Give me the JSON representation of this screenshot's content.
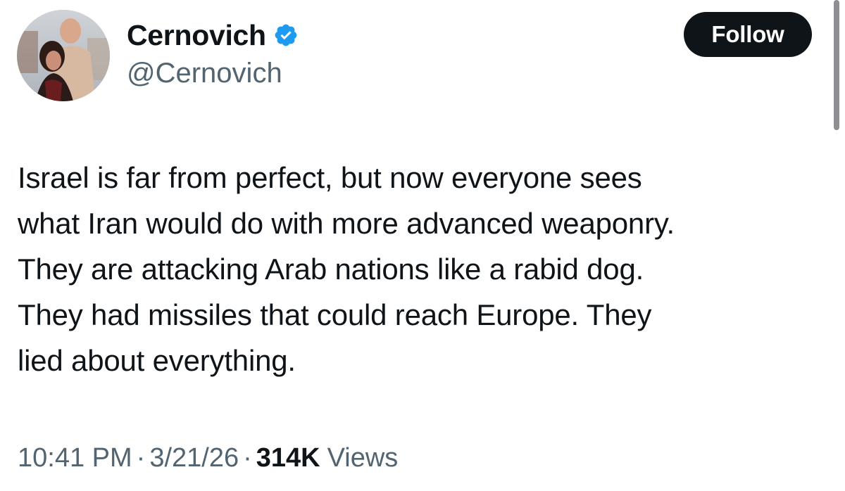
{
  "tweet": {
    "author": {
      "display_name": "Cernovich",
      "handle": "@Cernovich",
      "verified": true,
      "verified_icon": "verified-badge-icon",
      "verified_color": "#1d9bf0"
    },
    "follow_label": "Follow",
    "text": "Israel is far from perfect, but now everyone sees\nwhat Iran would do with more advanced weaponry.\nThey are attacking Arab nations like a rabid dog.\nThey had missiles that could reach Europe. They\nlied about everything.",
    "meta": {
      "time": "10:41 PM",
      "separator": "·",
      "date": "3/21/26",
      "views_count": "314K",
      "views_label": "Views"
    }
  },
  "colors": {
    "text_primary": "#0f1419",
    "text_secondary": "#536471",
    "follow_bg": "#0f1419",
    "follow_text": "#ffffff",
    "verified_blue": "#1d9bf0"
  }
}
